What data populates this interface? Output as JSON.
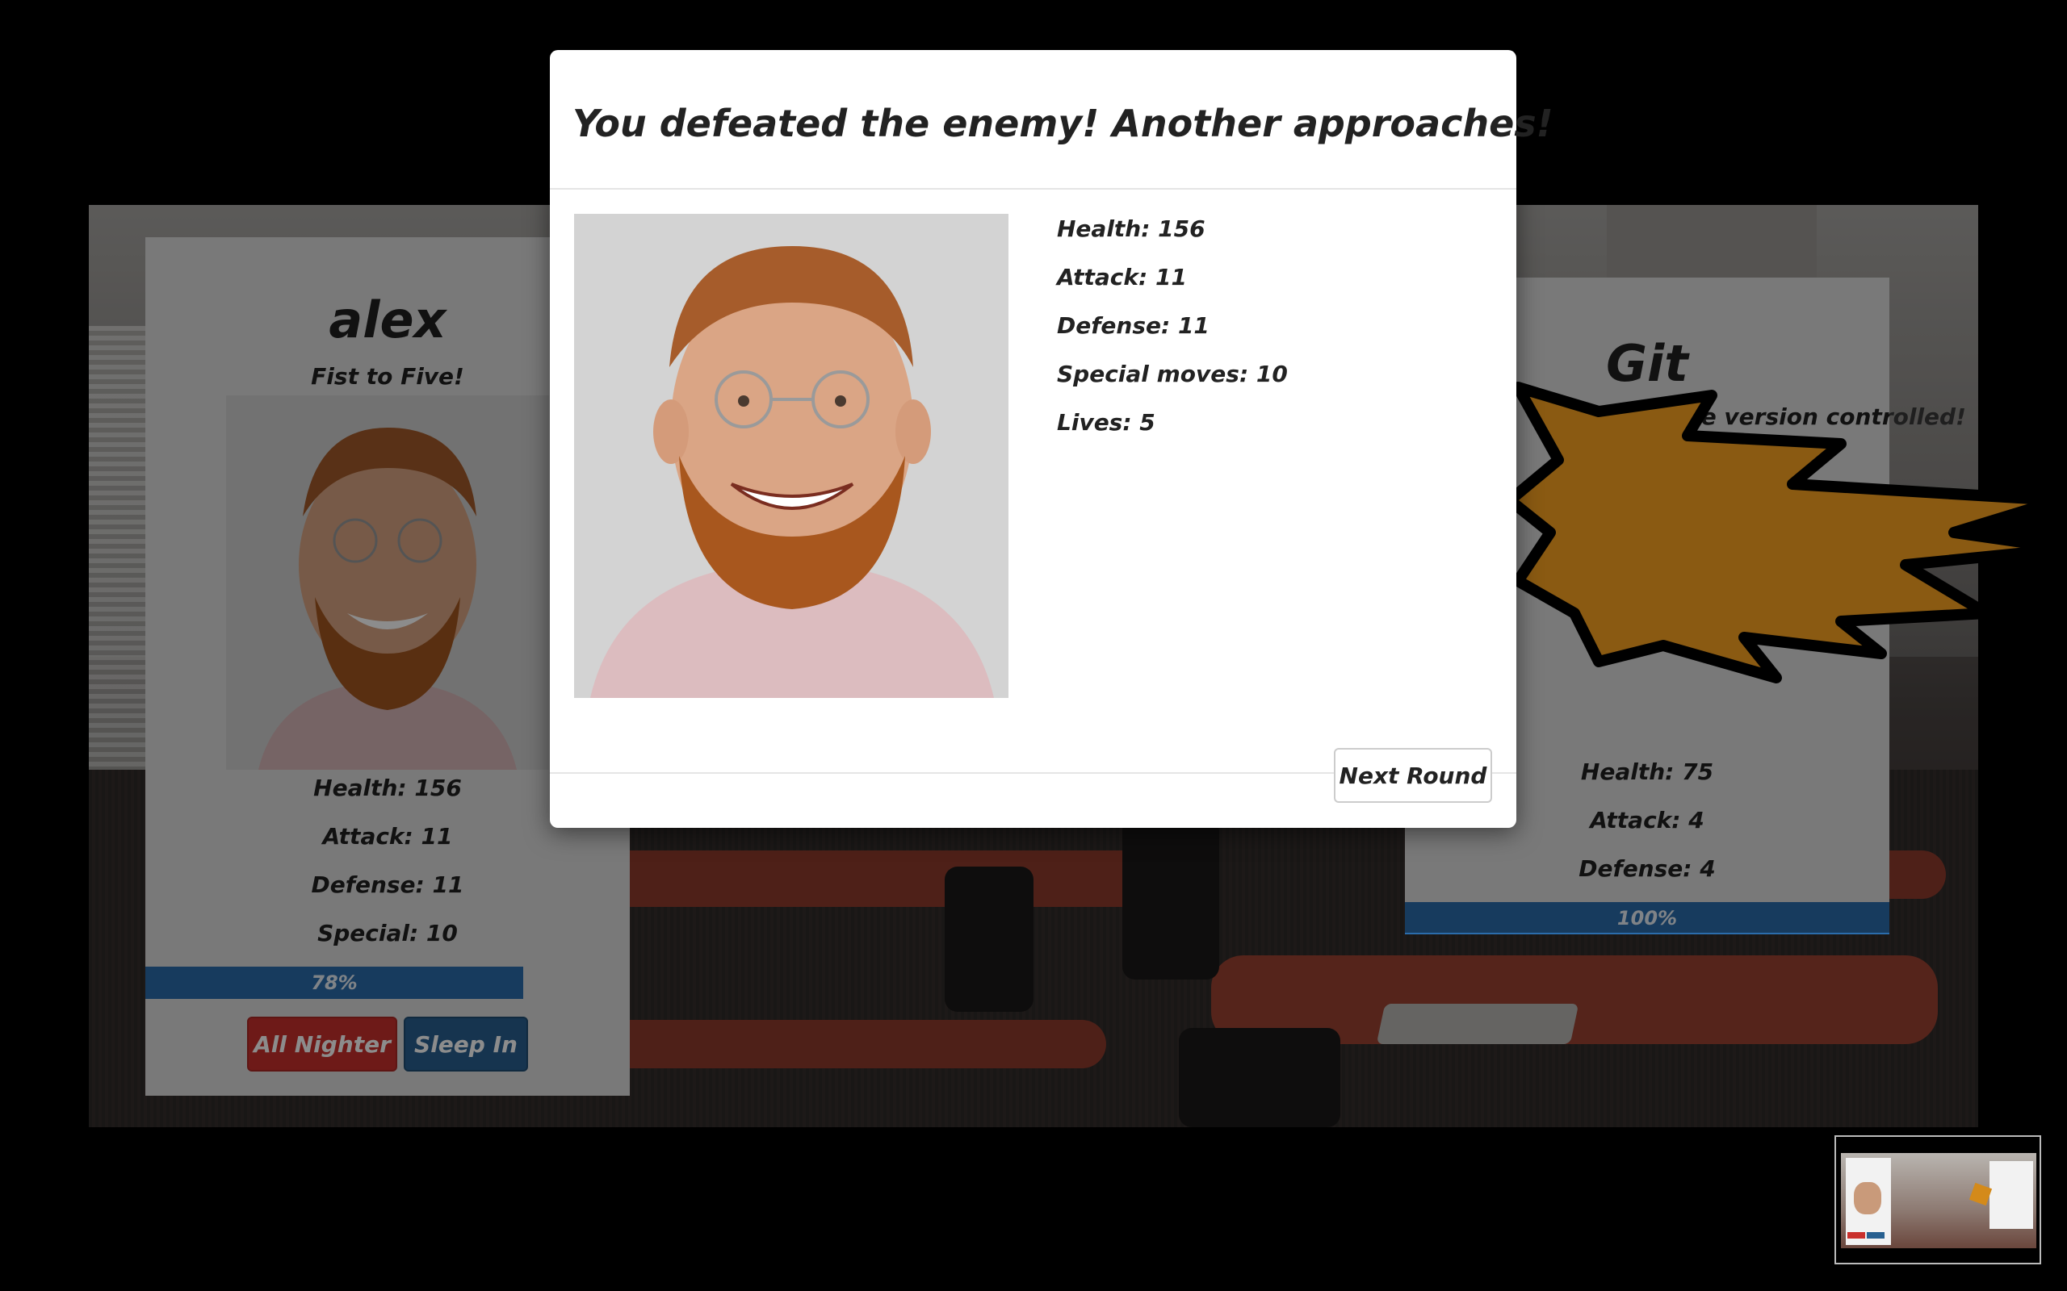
{
  "player": {
    "name": "alex",
    "tagline": "Fist to Five!",
    "stats": {
      "health": "Health: 156",
      "attack": "Attack: 11",
      "defense": "Defense: 11",
      "special": "Special: 10"
    },
    "health_bar": {
      "label": "78%",
      "value": 78
    },
    "buttons": {
      "all_nighter": "All Nighter",
      "sleep_in": "Sleep In"
    }
  },
  "enemy": {
    "name": "Git",
    "tagline": "repare to be version controlled!",
    "stats": {
      "health": "Health: 75",
      "attack": "Attack: 4",
      "defense": "Defense: 4"
    },
    "health_bar": {
      "label": "100%",
      "value": 100
    }
  },
  "modal": {
    "title": "You defeated the enemy! Another approaches!",
    "stats": {
      "health": "Health: 156",
      "attack": "Attack: 11",
      "defense": "Defense: 11",
      "special_moves": "Special moves: 10",
      "lives": "Lives: 5"
    },
    "next_button": "Next Round"
  },
  "colors": {
    "danger": "#c9302c",
    "primary": "#286090",
    "progress": "#2b6cab",
    "burst": "#d48a1a"
  }
}
